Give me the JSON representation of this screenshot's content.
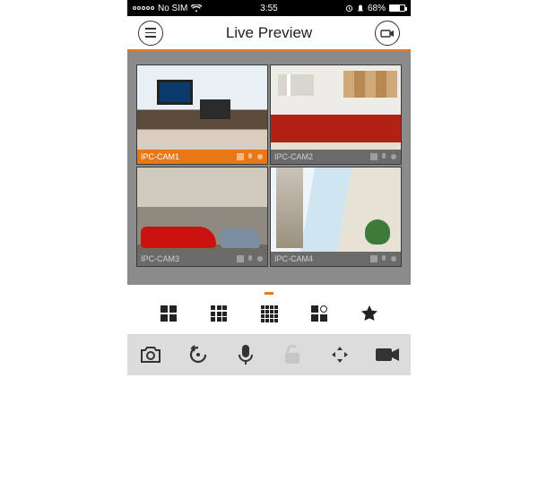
{
  "status": {
    "carrier": "No SIM",
    "time": "3:55",
    "battery_pct": "68%"
  },
  "header": {
    "title": "Live Preview"
  },
  "cameras": [
    {
      "name": "IPC-CAM1",
      "selected": true
    },
    {
      "name": "IPC-CAM2",
      "selected": false
    },
    {
      "name": "IPC-CAM3",
      "selected": false
    },
    {
      "name": "IPC-CAM4",
      "selected": false
    }
  ],
  "layout_modes": {
    "grid2x2": "2x2",
    "grid3x3": "3x3",
    "grid4x4": "4x4",
    "mixed": "mixed",
    "favorite": "favorite"
  },
  "toolbar": {
    "snapshot": "snapshot",
    "playback": "playback",
    "talk": "talk",
    "lock": "lock",
    "ptz": "ptz",
    "record": "record"
  }
}
